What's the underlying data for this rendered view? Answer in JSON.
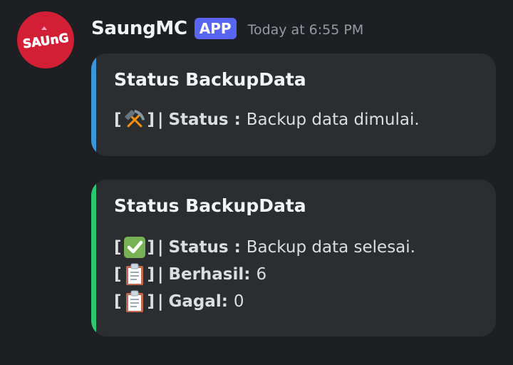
{
  "message": {
    "author": {
      "name": "SaungMC",
      "badge": "APP",
      "timestamp": "Today at 6:55 PM",
      "avatar_text": "SAUnG",
      "avatar_color": "#d31f35"
    },
    "embeds": [
      {
        "accent_color": "#3a97db",
        "title": "Status BackupData",
        "fields": [
          {
            "icon": "hammer-and-pick-icon",
            "label": "Status :",
            "value": "Backup data dimulai."
          }
        ]
      },
      {
        "accent_color": "#2dc770",
        "title": "Status BackupData",
        "fields": [
          {
            "icon": "check-mark-button-icon",
            "label": "Status :",
            "value": "Backup data selesai."
          },
          {
            "icon": "clipboard-icon",
            "label": "Berhasil:",
            "value": "6"
          },
          {
            "icon": "clipboard-icon",
            "label": "Gagal:",
            "value": "0"
          }
        ]
      }
    ]
  },
  "glyphs": {
    "bracket_open": "[",
    "bracket_close": "]",
    "separator": "|"
  }
}
